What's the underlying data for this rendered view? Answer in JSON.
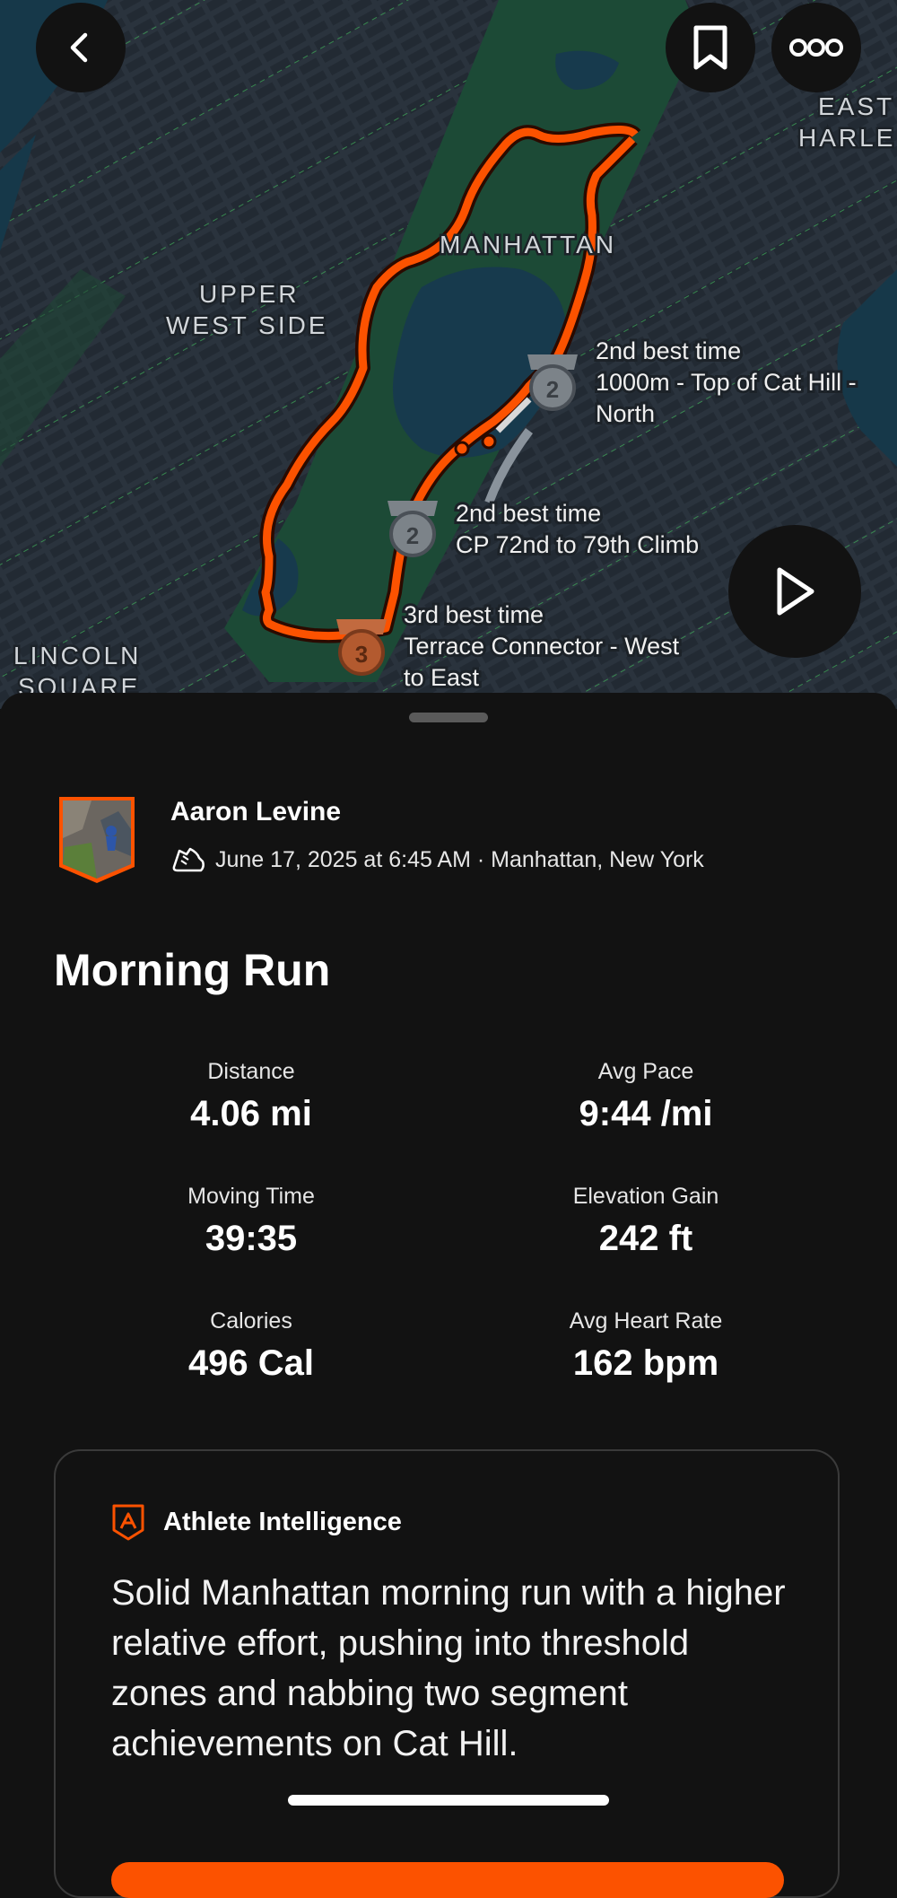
{
  "map": {
    "place_labels": {
      "manhattan": "MANHATTAN",
      "upper_west_side_1": "UPPER",
      "upper_west_side_2": "WEST SIDE",
      "lincoln_square_1": "LINCOLN",
      "lincoln_square_2": "SQUARE",
      "east_harlem_1": "EAST",
      "east_harlem_2": "HARLE"
    },
    "segments": [
      {
        "rank": "2",
        "line1": "2nd best time",
        "line2": "1000m - Top of Cat Hill -",
        "line3": "North"
      },
      {
        "rank": "2",
        "line1": "2nd best time",
        "line2": "CP 72nd to 79th Climb"
      },
      {
        "rank": "3",
        "line1": "3rd best time",
        "line2": "Terrace Connector - West",
        "line3": "to East"
      }
    ],
    "colors": {
      "route": "#fc5200",
      "water": "#173a4d",
      "park": "#1d4b37",
      "land": "#27303a"
    }
  },
  "toolbar": {
    "back_icon": "chevron-left-icon",
    "bookmark_icon": "bookmark-icon",
    "more_icon": "more-icon",
    "play_icon": "play-icon"
  },
  "activity": {
    "athlete_name": "Aaron Levine",
    "sport_icon": "shoe-icon",
    "meta": "June 17, 2025 at 6:45 AM · Manhattan, New York",
    "title": "Morning Run",
    "stats": [
      {
        "label": "Distance",
        "value": "4.06 mi"
      },
      {
        "label": "Avg Pace",
        "value": "9:44 /mi"
      },
      {
        "label": "Moving Time",
        "value": "39:35"
      },
      {
        "label": "Elevation Gain",
        "value": "242 ft"
      },
      {
        "label": "Calories",
        "value": "496 Cal"
      },
      {
        "label": "Avg Heart Rate",
        "value": "162 bpm"
      }
    ]
  },
  "athlete_intelligence": {
    "title": "Athlete Intelligence",
    "summary": "Solid Manhattan morning run with a higher relative effort, pushing into threshold zones and nabbing two segment achievements on Cat Hill."
  }
}
